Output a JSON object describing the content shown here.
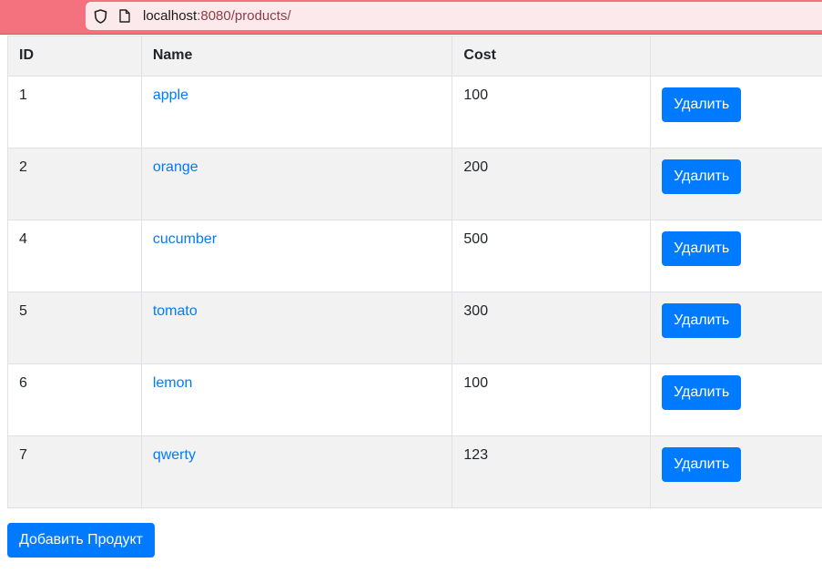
{
  "browser": {
    "url_host": "localhost",
    "url_rest": ":8080/products/"
  },
  "table": {
    "headers": [
      "ID",
      "Name",
      "Cost",
      ""
    ],
    "rows": [
      {
        "id": "1",
        "name": "apple",
        "cost": "100",
        "action": "Удалить"
      },
      {
        "id": "2",
        "name": "orange",
        "cost": "200",
        "action": "Удалить"
      },
      {
        "id": "4",
        "name": "cucumber",
        "cost": "500",
        "action": "Удалить"
      },
      {
        "id": "5",
        "name": "tomato",
        "cost": "300",
        "action": "Удалить"
      },
      {
        "id": "6",
        "name": "lemon",
        "cost": "100",
        "action": "Удалить"
      },
      {
        "id": "7",
        "name": "qwerty",
        "cost": "123",
        "action": "Удалить"
      }
    ]
  },
  "add_button_label": "Добавить Продукт",
  "colors": {
    "toolbar": "#f3727e",
    "accent": "#007bff",
    "stripe": "#f2f2f2"
  }
}
